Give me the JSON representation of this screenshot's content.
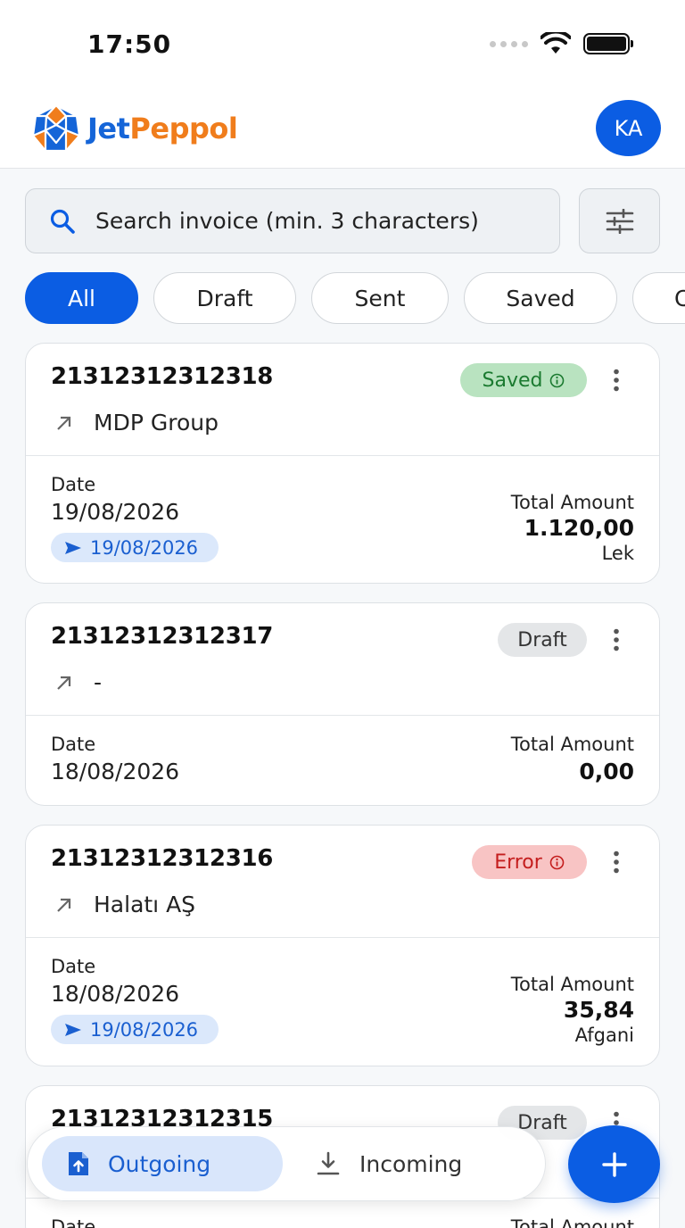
{
  "status_bar": {
    "time": "17:50"
  },
  "header": {
    "logo_part1": "Jet",
    "logo_part2": "Peppol",
    "avatar_initials": "KA"
  },
  "search": {
    "placeholder": "Search invoice (min. 3 characters)"
  },
  "filters": [
    "All",
    "Draft",
    "Sent",
    "Saved",
    "C"
  ],
  "invoices": [
    {
      "number": "21312312312318",
      "status": "Saved",
      "party": "MDP Group",
      "date_label": "Date",
      "date": "19/08/2026",
      "sent_date": "19/08/2026",
      "total_label": "Total Amount",
      "total": "1.120,00",
      "currency": "Lek"
    },
    {
      "number": "21312312312317",
      "status": "Draft",
      "party": "-",
      "date_label": "Date",
      "date": "18/08/2026",
      "total_label": "Total Amount",
      "total": "0,00"
    },
    {
      "number": "21312312312316",
      "status": "Error",
      "party": "Halatı AŞ",
      "date_label": "Date",
      "date": "18/08/2026",
      "sent_date": "19/08/2026",
      "total_label": "Total Amount",
      "total": "35,84",
      "currency": "Afgani"
    },
    {
      "number": "21312312312315",
      "status": "Draft",
      "date_label": "Date",
      "total_label": "Total Amount"
    }
  ],
  "bottom_nav": {
    "outgoing": "Outgoing",
    "incoming": "Incoming"
  },
  "colors": {
    "primary": "#0b5de3",
    "saved_bg": "#b9e3c0",
    "error_bg": "#f8c4c4",
    "draft_bg": "#e4e6e8"
  },
  "icons": {
    "search": "search-icon",
    "filter": "sliders-icon",
    "party": "arrow-up-right-icon",
    "more": "more-vertical-icon",
    "sent": "send-icon",
    "outgoing": "file-upload-icon",
    "incoming": "download-icon",
    "fab": "plus-icon"
  }
}
